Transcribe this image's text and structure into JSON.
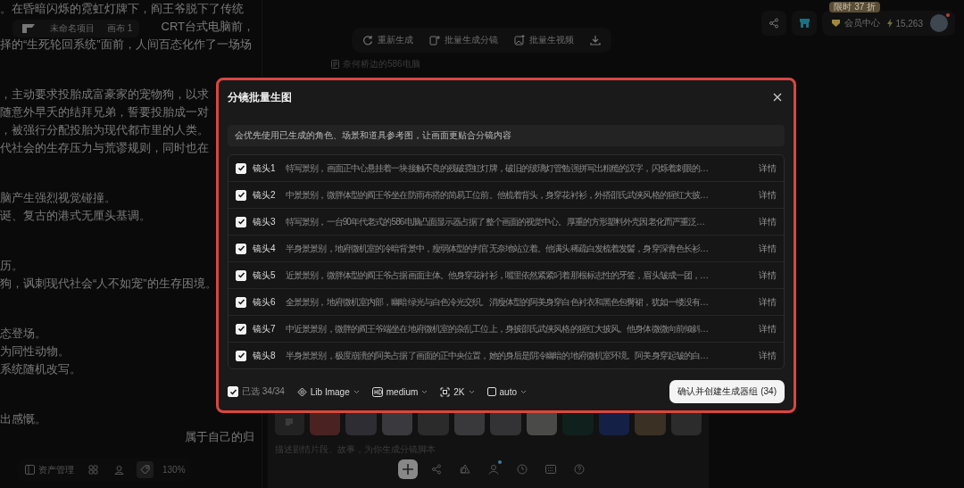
{
  "header": {
    "project": "未命名项目",
    "canvas": "画布 1"
  },
  "story": {
    "paragraphs": [
      {
        "lines": [
          {
            "text": "。在昏暗闪烁的霓虹灯牌下，阎王爷脱下了传统",
            "kind": "full"
          },
          {
            "text": "CRT台式电脑前，",
            "kind": "tail"
          },
          {
            "text": "择的“生死轮回系统”面前，人间百态化作了一场场",
            "kind": "full"
          }
        ]
      },
      {
        "lines": [
          {
            "text": "，主动要求投胎成富豪家的宠物狗，以求",
            "kind": "full"
          },
          {
            "text": "随意外早夭的结拜兄弟，誓要投胎成一对",
            "kind": "full"
          },
          {
            "text": "，被强行分配投胎为现代都市里的人类。",
            "kind": "full"
          },
          {
            "text": "代社会的生存压力与荒谬规则，同时也在",
            "kind": "full"
          }
        ]
      },
      {
        "lines": [
          {
            "text": "脑产生强烈视觉碰撞。",
            "kind": "full"
          },
          {
            "text": "诞、复古的港式无厘头基调。",
            "kind": "full"
          }
        ]
      },
      {
        "lines": [
          {
            "text": "历。",
            "kind": "full"
          },
          {
            "text": "狗，讽刺现代社会“人不如宠”的生存困境。",
            "kind": "full"
          }
        ]
      },
      {
        "lines": [
          {
            "text": "态登场。",
            "kind": "full"
          },
          {
            "text": "为同性动物。",
            "kind": "full"
          },
          {
            "text": "系统随机改写。",
            "kind": "full"
          }
        ]
      },
      {
        "lines": [
          {
            "text": "出感慨。",
            "kind": "full"
          },
          {
            "text": "属于自己的归",
            "kind": "tail"
          }
        ]
      }
    ]
  },
  "toolbar": {
    "buttons": [
      {
        "label": "重新生成",
        "kind": "regenerate"
      },
      {
        "label": "批量生成分镜",
        "kind": "storyboard"
      },
      {
        "label": "批量生视频",
        "kind": "video"
      },
      {
        "kind": "download"
      }
    ]
  },
  "document_title": "奈何桥边的586电脑",
  "account": {
    "promo_badge": "限时 37 折",
    "member_center": "会员中心",
    "credits": "15,263",
    "notification": true
  },
  "modal": {
    "title": "分镜批量生图",
    "notice": "会优先使用已生成的角色、场景和道具参考图，让画面更贴合分镜内容",
    "shots": [
      {
        "label": "镜头1",
        "description": "特写景别，画面正中心悬挂着一块接触不良的残破霓虹灯牌，破旧的玻璃灯管勉强拼写出粗糙的汉字，闪烁着刺眼的…",
        "detail": "详情",
        "checked": true
      },
      {
        "label": "镜头2",
        "description": "中景景别，微胖体型的阎王爷坐在防雨布搭的简易工位前。他梳着背头，身穿花衬衫，外搭邵氏武侠风格的猩红大披…",
        "detail": "详情",
        "checked": true
      },
      {
        "label": "镜头3",
        "description": "特写景别，一台90年代老式的586电脑凸面显示器占据了整个画面的视觉中心。厚重的方形塑料外壳因老化而严重泛…",
        "detail": "详情",
        "checked": true
      },
      {
        "label": "镜头4",
        "description": "半身景景别，地府微机室的冷暗背景中，瘦弱体型的判官无奈地站立着。他满头稀疏白发梳着发髻，身穿深青色长衫…",
        "detail": "详情",
        "checked": true
      },
      {
        "label": "镜头5",
        "description": "近景景别，微胖体型的阎王爷占据画面主体。他身穿花衬衫，嘴里依然紧紧叼着那根标志性的牙签，眉头皱成一团，…",
        "detail": "详情",
        "checked": true
      },
      {
        "label": "镜头6",
        "description": "全景景别，地府微机室内部，幽暗绿光与白色冷光交织。消瘦体型的阿美身穿白色衬衣和黑色包臀裙，犹如一缕没有…",
        "detail": "详情",
        "checked": true
      },
      {
        "label": "镜头7",
        "description": "中近景景别，微胖的阎王爷端坐在地府微机室的杂乱工位上，身披邵氏武侠风格的猩红大披风。他身体微微向前倾斜…",
        "detail": "详情",
        "checked": true
      },
      {
        "label": "镜头8",
        "description": "半身景景别，极度崩溃的阿美占据了画面的正中央位置，她的身后是阴冷幽暗的地府微机室环境。阿美身穿起皱的白…",
        "detail": "详情",
        "checked": true
      }
    ],
    "select_all": {
      "label": "已选 34/34",
      "checked": true
    },
    "options": [
      {
        "label": "Lib Image",
        "kind": "model"
      },
      {
        "label": "medium",
        "kind": "quality"
      },
      {
        "label": "2K",
        "kind": "resolution"
      },
      {
        "label": "auto",
        "kind": "ratio"
      }
    ],
    "confirm": "确认并创建生成器组 (34)"
  },
  "composer": {
    "placeholder": "描述剧情片段、故事，为你生成分镜脚本",
    "tools": [
      {
        "kind": "add",
        "selected": true,
        "badge": false
      },
      {
        "kind": "share",
        "selected": false,
        "badge": false
      },
      {
        "kind": "shapes",
        "selected": false,
        "badge": false
      },
      {
        "kind": "person",
        "selected": false,
        "badge": true
      },
      {
        "kind": "clock",
        "selected": false,
        "badge": false
      },
      {
        "kind": "keyboard",
        "selected": false,
        "badge": false
      },
      {
        "kind": "help",
        "selected": false,
        "badge": false
      }
    ]
  },
  "bottom_left": {
    "assets_label": "资产管理",
    "zoom": "130%",
    "tools": [
      {
        "kind": "grid",
        "selected": false
      },
      {
        "kind": "person",
        "selected": false
      },
      {
        "kind": "tag",
        "selected": true
      }
    ]
  }
}
